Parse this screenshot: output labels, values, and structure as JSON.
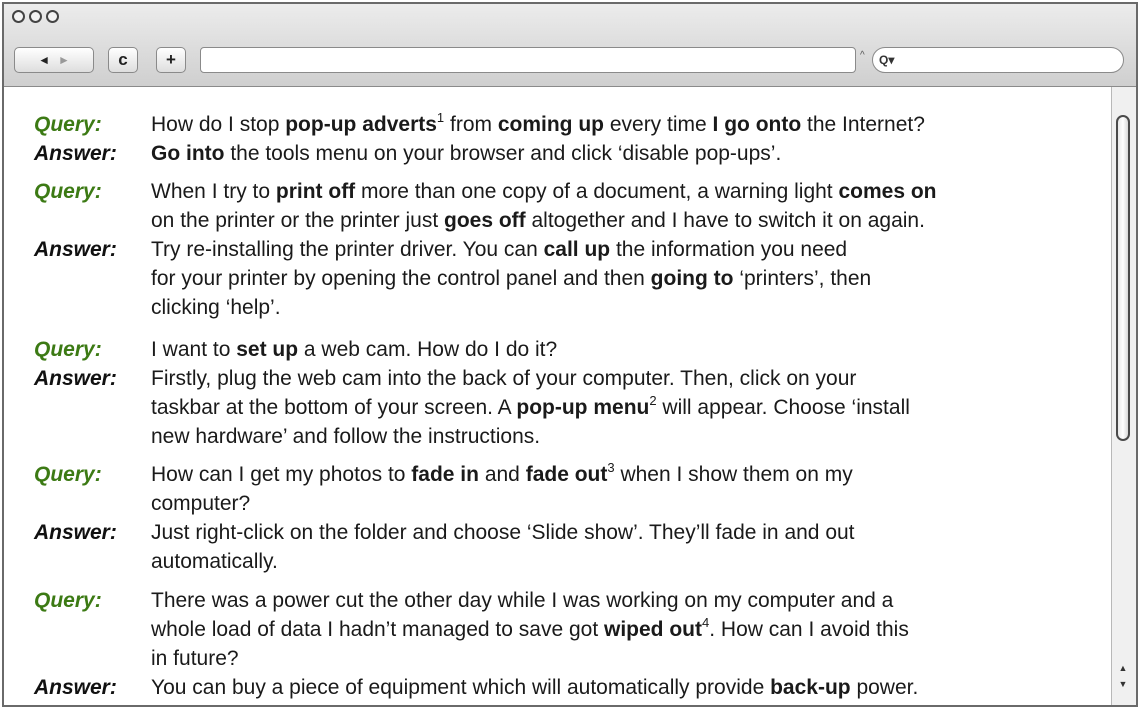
{
  "browser": {
    "nav_back": "◄",
    "nav_forward": "►",
    "reload_label": "c",
    "add_label": "+",
    "search_prefix": "Q▾"
  },
  "entries": [
    {
      "query_label": "Query:",
      "answer_label": "Answer:",
      "query_lines": [
        "How do I stop <b>pop-up adverts</b><sup>1</sup> from <b>coming up</b> every time <b>I go onto</b> the Internet?"
      ],
      "answer_lines": [
        "<b>Go into</b> the tools menu on your browser and click ‘disable pop-ups’."
      ]
    },
    {
      "query_label": "Query:",
      "answer_label": "Answer:",
      "query_lines": [
        "When I try to <b>print off</b> more than one copy of a document, a warning light <b>comes on</b>",
        "on the printer or the printer just <b>goes off</b> altogether and I have to switch it on again."
      ],
      "answer_lines": [
        "Try re-installing the printer driver. You can <b>call up</b> the information you need",
        "for your printer by opening the control panel and then <b>going to</b> ‘printers’, then",
        "clicking ‘help’."
      ]
    },
    {
      "query_label": "Query:",
      "answer_label": "Answer:",
      "query_lines": [
        "I want to <b>set up</b> a web cam. How do I do it?"
      ],
      "answer_lines": [
        "Firstly, plug the web cam into the back of your computer. Then, click on your",
        "taskbar at the bottom of your screen. A <b>pop-up menu</b><sup>2</sup> will appear. Choose ‘install",
        "new hardware’ and follow the instructions."
      ]
    },
    {
      "query_label": "Query:",
      "answer_label": "Answer:",
      "query_lines": [
        "How can I get my photos to <b>fade in</b> and <b>fade out</b><sup>3</sup> when I show them on my",
        "computer?"
      ],
      "answer_lines": [
        "Just right-click on the folder and choose ‘Slide show’. They’ll fade in and out",
        "automatically."
      ]
    },
    {
      "query_label": "Query:",
      "answer_label": "Answer:",
      "query_lines": [
        "There was a power cut the other day while I was working on my computer and a",
        "whole load of data I hadn’t managed to save got <b>wiped out</b><sup>4</sup>. How can I avoid this",
        "in future?"
      ],
      "answer_lines": [
        "You can buy a piece of equipment which will automatically provide <b>back-up</b> power."
      ]
    }
  ]
}
